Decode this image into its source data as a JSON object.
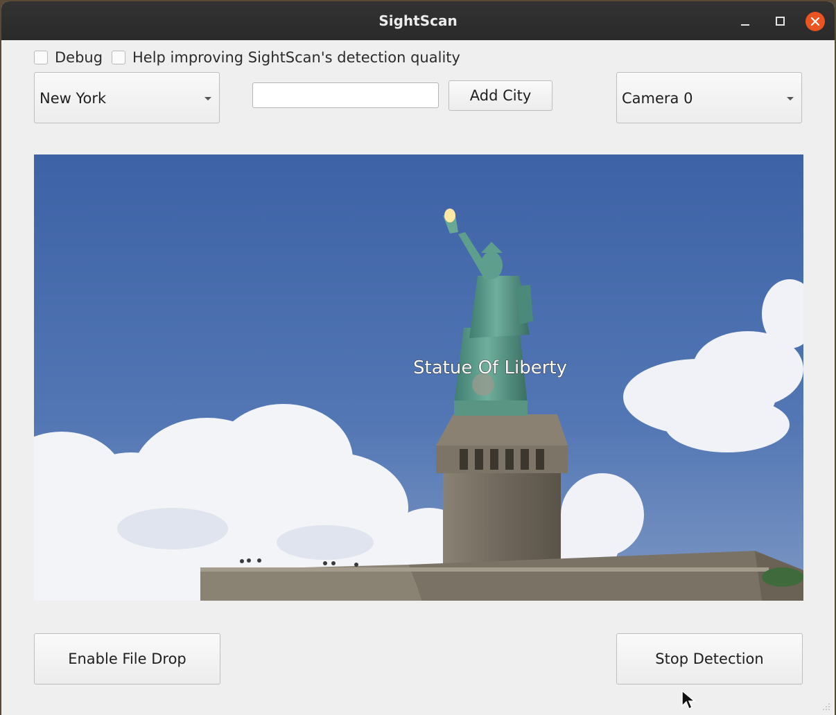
{
  "window": {
    "title": "SightScan"
  },
  "options": {
    "debug_label": "Debug",
    "help_label": "Help improving SightScan's detection quality"
  },
  "city_select": {
    "selected": "New York"
  },
  "city_input": {
    "value": "",
    "placeholder": ""
  },
  "add_city_label": "Add City",
  "camera_select": {
    "selected": "Camera 0"
  },
  "video": {
    "detection_label": "Statue Of Liberty"
  },
  "file_drop_label": "Enable File Drop",
  "stop_label": "Stop Detection",
  "colors": {
    "close_button": "#e95420",
    "sky": "#4a6fae",
    "statue": "#5e9c8c"
  }
}
